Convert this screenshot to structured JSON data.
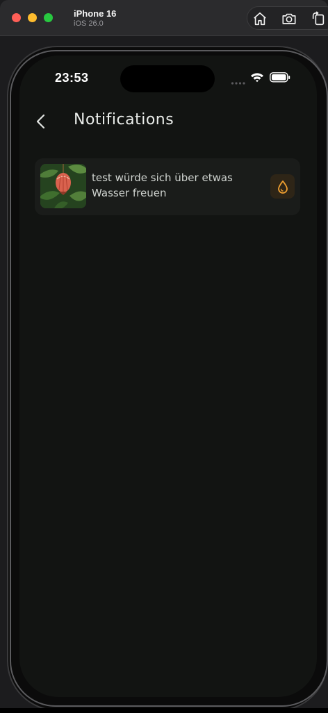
{
  "simulator": {
    "device_name": "iPhone 16",
    "os_version": "iOS 26.0",
    "tools": [
      "home-icon",
      "screenshot-icon",
      "rotate-icon"
    ]
  },
  "status_bar": {
    "time": "23:53",
    "icons": [
      "signal-icon",
      "wifi-icon",
      "battery-icon"
    ]
  },
  "nav": {
    "back_icon": "chevron-left-icon",
    "title": "Notifications"
  },
  "notifications": [
    {
      "message": "test würde sich über etwas Wasser freuen",
      "thumbnail": "plant-photo",
      "action_icon": "water-drop-icon"
    }
  ],
  "colors": {
    "background": "#121412",
    "card": "#1a1c1a",
    "accent": "#f0a030",
    "accent_bg": "#2e2517",
    "text": "#cfd3cf"
  }
}
